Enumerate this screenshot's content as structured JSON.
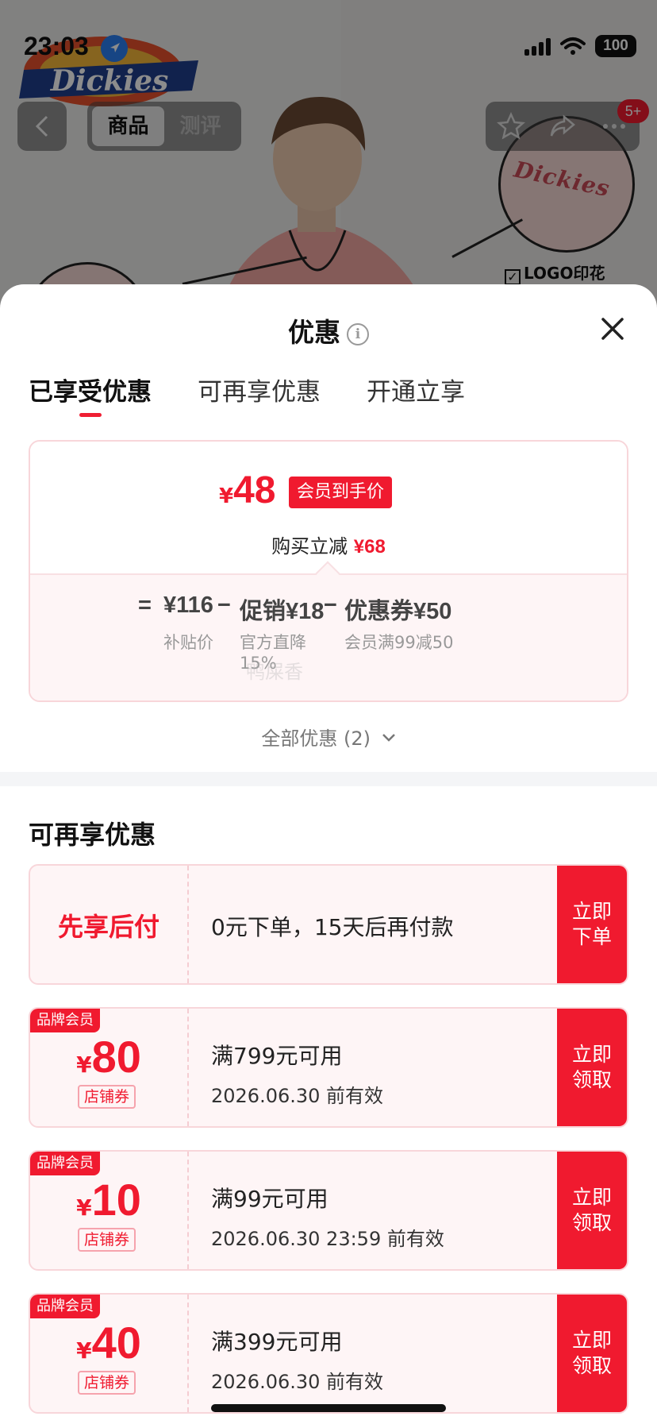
{
  "status_bar": {
    "time": "23:03",
    "battery": "100"
  },
  "background": {
    "brand_logo": "Dickies",
    "zoom_text": "Dickies",
    "feature_tag": "LOGO印花",
    "nav_tabs": [
      "商品",
      "测评"
    ],
    "badge": "5+"
  },
  "sheet": {
    "title": "优惠",
    "tabs": [
      "已享受优惠",
      "可再享优惠",
      "开通立享"
    ],
    "price": {
      "currency": "¥",
      "amount": "48",
      "tag": "会员到手价",
      "save_prefix": "购买立减",
      "save_amount": "¥68"
    },
    "formula": {
      "equals": "=",
      "base": "¥116",
      "minus1": "−",
      "promo": "促销¥18",
      "minus2": "−",
      "coupon": "优惠券¥50",
      "base_label": "补贴价",
      "promo_label": "官方直降15%",
      "coupon_label": "会员满99减50"
    },
    "watermark": "鸭屎香",
    "all_offers": "全部优惠 (2)"
  },
  "more_offers": {
    "title": "可再享优惠",
    "bnpl": {
      "label": "先享后付",
      "desc": "0元下单，15天后再付款",
      "button": "立即下单"
    },
    "coupons": [
      {
        "tag": "品牌会员",
        "currency": "¥",
        "amount": "80",
        "type": "店铺券",
        "condition": "满799元可用",
        "validity": "2026.06.30 前有效",
        "button": "立即领取"
      },
      {
        "tag": "品牌会员",
        "currency": "¥",
        "amount": "10",
        "type": "店铺券",
        "condition": "满99元可用",
        "validity": "2026.06.30 23:59 前有效",
        "button": "立即领取"
      },
      {
        "tag": "品牌会员",
        "currency": "¥",
        "amount": "40",
        "type": "店铺券",
        "condition": "满399元可用",
        "validity": "2026.06.30 前有效",
        "button": "立即领取"
      }
    ]
  },
  "colors": {
    "accent": "#f01a2f",
    "card_bg": "#fef5f6",
    "card_border": "#f8d6da"
  }
}
